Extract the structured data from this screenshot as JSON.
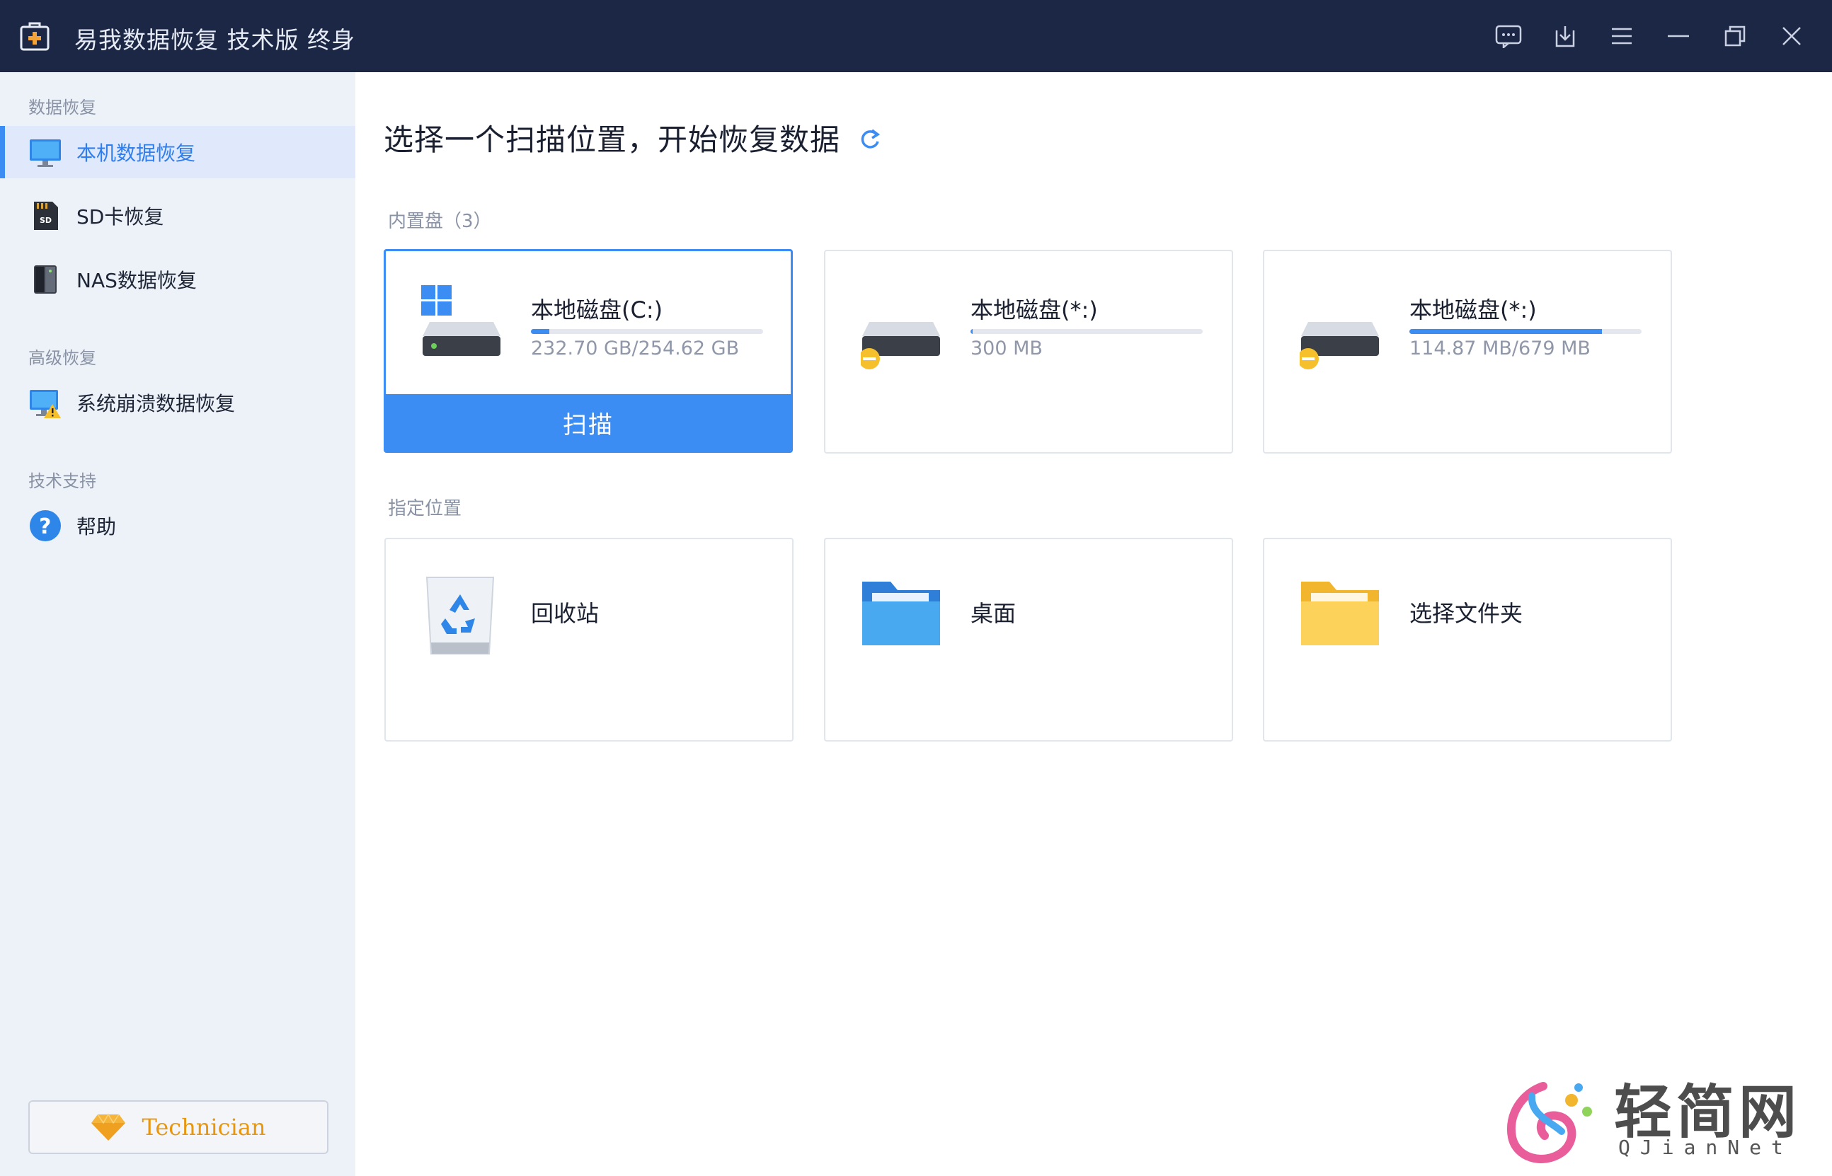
{
  "window": {
    "title": "易我数据恢复 技术版 终身"
  },
  "titlebar": {
    "buttons": [
      {
        "name": "feedback-icon"
      },
      {
        "name": "download-icon"
      },
      {
        "name": "menu-icon"
      },
      {
        "name": "minimize-icon"
      },
      {
        "name": "restore-icon"
      },
      {
        "name": "close-icon"
      }
    ]
  },
  "sidebar": {
    "section_data_recovery": "数据恢复",
    "section_advanced": "高级恢复",
    "section_support": "技术支持",
    "items": [
      {
        "label": "本机数据恢复",
        "icon": "monitor-icon",
        "active": true
      },
      {
        "label": "SD卡恢复",
        "icon": "sd-card-icon",
        "active": false
      },
      {
        "label": "NAS数据恢复",
        "icon": "nas-icon",
        "active": false
      },
      {
        "label": "系统崩溃数据恢复",
        "icon": "system-crash-icon",
        "active": false
      },
      {
        "label": "帮助",
        "icon": "help-icon",
        "active": false
      }
    ],
    "edition_button": "Technician"
  },
  "main": {
    "heading": "选择一个扫描位置，开始恢复数据",
    "internal_label": "内置盘（3）",
    "location_label": "指定位置",
    "drives": [
      {
        "name": "本地磁盘(C:)",
        "size": "232.70 GB/254.62 GB",
        "usage": 0.08,
        "selected": true,
        "scan_label": "扫描"
      },
      {
        "name": "本地磁盘(*:)",
        "size": "300 MB",
        "usage": 0.01,
        "selected": false
      },
      {
        "name": "本地磁盘(*:)",
        "size": "114.87 MB/679 MB",
        "usage": 0.83,
        "selected": false
      }
    ],
    "locations": [
      {
        "name": "回收站",
        "icon": "recycle-bin-icon"
      },
      {
        "name": "桌面",
        "icon": "desktop-folder-icon"
      },
      {
        "name": "选择文件夹",
        "icon": "folder-icon"
      }
    ]
  },
  "watermark": {
    "text": "轻简网",
    "sub": "QJianNet"
  },
  "colors": {
    "accent": "#3b8cf3",
    "titlebar": "#1c2746",
    "sidebar": "#edf1f8",
    "technician": "#e8960c"
  }
}
